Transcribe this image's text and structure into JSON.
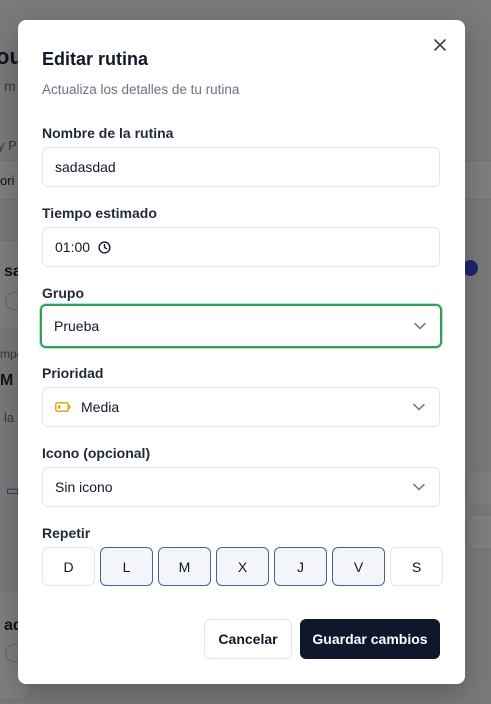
{
  "background": {
    "fragments": [
      "ou",
      "m",
      "y P",
      "ori",
      "sa",
      "mpo",
      "M",
      "la",
      "ad"
    ]
  },
  "modal": {
    "title": "Editar rutina",
    "subtitle": "Actualiza los detalles de tu rutina",
    "name": {
      "label": "Nombre de la rutina",
      "value": "sadasdad"
    },
    "time": {
      "label": "Tiempo estimado",
      "value": "01:00"
    },
    "group": {
      "label": "Grupo",
      "value": "Prueba"
    },
    "priority": {
      "label": "Prioridad",
      "value": "Media",
      "icon_color": "#e0a100"
    },
    "icon": {
      "label": "Icono (opcional)",
      "value": "Sin icono"
    },
    "repeat": {
      "label": "Repetir",
      "days": [
        {
          "label": "D",
          "selected": false
        },
        {
          "label": "L",
          "selected": true
        },
        {
          "label": "M",
          "selected": true
        },
        {
          "label": "X",
          "selected": true
        },
        {
          "label": "J",
          "selected": true
        },
        {
          "label": "V",
          "selected": true
        },
        {
          "label": "S",
          "selected": false
        }
      ]
    },
    "cancel_label": "Cancelar",
    "save_label": "Guardar cambios"
  },
  "colors": {
    "accent_focus": "#2e9e58",
    "primary": "#0f172a",
    "day_selected_border": "#4a5fa7"
  }
}
